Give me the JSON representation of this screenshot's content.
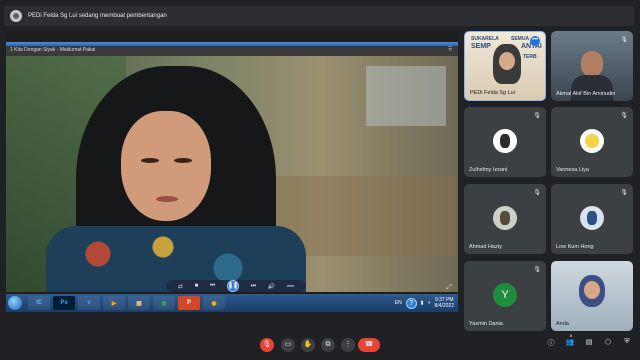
{
  "meet": {
    "presentation_banner": "PEDi Felda Sg Lui sedang membuat pembentangan"
  },
  "screen": {
    "window_title": "1 Kita Dengan Siyak - Maklumat Pakai",
    "taskbar": {
      "apps": [
        "IE",
        "Ps",
        "e",
        "▶",
        "▦",
        "◉",
        "P",
        "◉"
      ],
      "language": "EN",
      "time": "9:37 PM",
      "date": "8/4/2022"
    }
  },
  "participants": [
    {
      "name": "PEDi Felda Sg Lui",
      "banner": [
        "SUKARELA",
        "SEMUA",
        "SEMP",
        "ANTAI",
        "TERB"
      ]
    },
    {
      "name": "Akmal Akif Bin Aminudin"
    },
    {
      "name": "Zulhelmy Izzani"
    },
    {
      "name": "Vannesa Liya"
    },
    {
      "name": "Ahmad Hazty"
    },
    {
      "name": "Low Kum Hong"
    },
    {
      "name": "Yasmin Dania",
      "initial": "Y"
    },
    {
      "name": "Anda"
    }
  ],
  "controls": {
    "mic": "mic-off-icon",
    "camera": "camera-off-icon",
    "people_count": "8"
  },
  "colors": {
    "end_call": "#ea4335",
    "accent": "#1a73e8",
    "tile": "#3c4043"
  }
}
